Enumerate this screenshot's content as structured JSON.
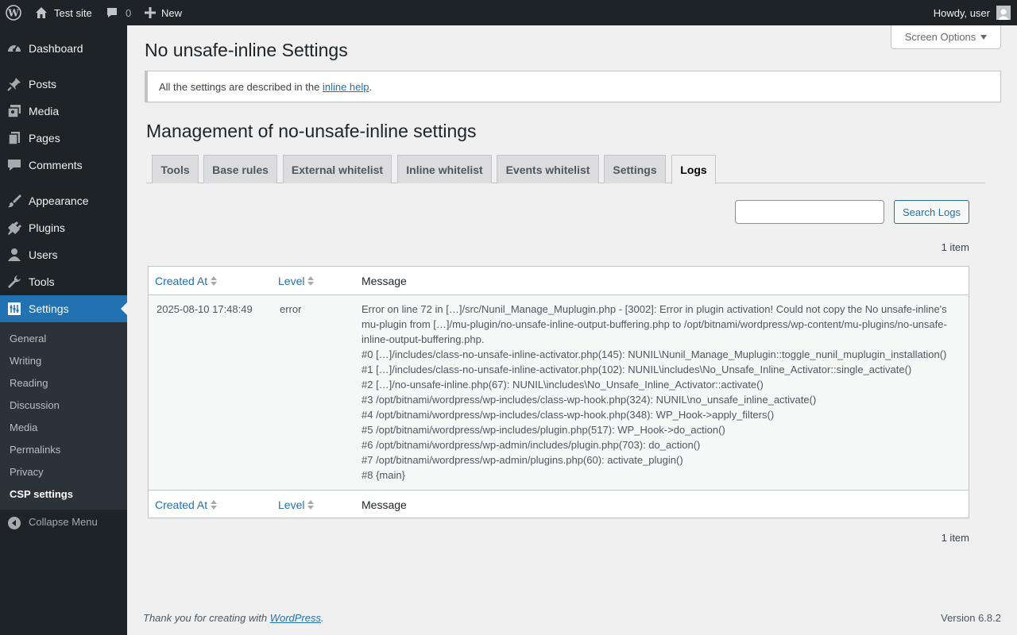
{
  "adminbar": {
    "site_name": "Test site",
    "comments_count": "0",
    "new_label": "New",
    "greeting": "Howdy, user"
  },
  "sidebar": {
    "items": [
      {
        "label": "Dashboard",
        "icon": "dashboard-icon"
      },
      {
        "label": "Posts",
        "icon": "pin-icon"
      },
      {
        "label": "Media",
        "icon": "media-icon"
      },
      {
        "label": "Pages",
        "icon": "pages-icon"
      },
      {
        "label": "Comments",
        "icon": "comment-icon"
      },
      {
        "label": "Appearance",
        "icon": "brush-icon"
      },
      {
        "label": "Plugins",
        "icon": "plug-icon"
      },
      {
        "label": "Users",
        "icon": "user-icon"
      },
      {
        "label": "Tools",
        "icon": "wrench-icon"
      },
      {
        "label": "Settings",
        "icon": "settings-icon"
      }
    ],
    "submenu": [
      "General",
      "Writing",
      "Reading",
      "Discussion",
      "Media",
      "Permalinks",
      "Privacy",
      "CSP settings"
    ],
    "collapse_label": "Collapse Menu"
  },
  "screen_options": "Screen Options",
  "page_title": "No unsafe-inline Settings",
  "notice": {
    "text_before": "All the settings are described in the ",
    "link": "inline help",
    "text_after": "."
  },
  "section_title": "Management of no-unsafe-inline settings",
  "tabs": [
    "Tools",
    "Base rules",
    "External whitelist",
    "Inline whitelist",
    "Events whitelist",
    "Settings",
    "Logs"
  ],
  "active_tab": "Logs",
  "search": {
    "value": "",
    "button": "Search Logs"
  },
  "item_count": "1 item",
  "table": {
    "columns": [
      "Created At",
      "Level",
      "Message"
    ],
    "rows": [
      {
        "created_at": "2025-08-10 17:48:49",
        "level": "error",
        "message_lines": [
          "Error on line 72 in […]/src/Nunil_Manage_Muplugin.php - [3002]: Error in plugin activation! Could not copy the No unsafe-inline's",
          "mu-plugin from […]/mu-plugin/no-unsafe-inline-output-buffering.php to /opt/bitnami/wordpress/wp-content/mu-plugins/no-unsafe-",
          "inline-output-buffering.php.",
          "#0 […]/includes/class-no-unsafe-inline-activator.php(145): NUNIL\\Nunil_Manage_Muplugin::toggle_nunil_muplugin_installation()",
          "#1 […]/includes/class-no-unsafe-inline-activator.php(102): NUNIL\\includes\\No_Unsafe_Inline_Activator::single_activate()",
          "#2 […]/no-unsafe-inline.php(67): NUNIL\\includes\\No_Unsafe_Inline_Activator::activate()",
          "#3 /opt/bitnami/wordpress/wp-includes/class-wp-hook.php(324): NUNIL\\no_unsafe_inline_activate()",
          "#4 /opt/bitnami/wordpress/wp-includes/class-wp-hook.php(348): WP_Hook->apply_filters()",
          "#5 /opt/bitnami/wordpress/wp-includes/plugin.php(517): WP_Hook->do_action()",
          "#6 /opt/bitnami/wordpress/wp-admin/includes/plugin.php(703): do_action()",
          "#7 /opt/bitnami/wordpress/wp-admin/plugins.php(60): activate_plugin()",
          "#8 {main}"
        ]
      }
    ]
  },
  "footer": {
    "thanks_before": "Thank you for creating with ",
    "thanks_link": "WordPress",
    "thanks_after": ".",
    "version": "Version 6.8.2"
  },
  "colors": {
    "accent": "#2271b1",
    "admin_bg": "#1d2327",
    "submenu_bg": "#2c3338",
    "page_bg": "#f0f0f1"
  }
}
